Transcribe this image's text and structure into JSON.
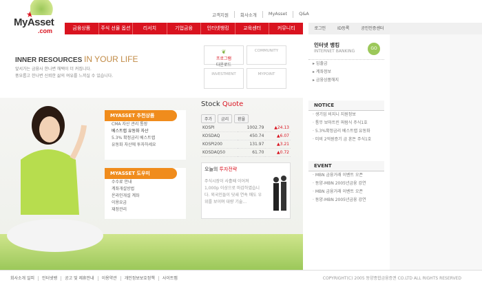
{
  "logo": {
    "name": "MyAsset",
    "domain": ".com"
  },
  "topnav": [
    "고객지원",
    "회사소개",
    "MyAsset",
    "Q&A"
  ],
  "menu": [
    "금융상품",
    "주식 선물 옵션",
    "리서치",
    "기업금융",
    "인터넷뱅킹",
    "교육센터",
    "커뮤니티"
  ],
  "util": [
    "로그인",
    "ID등록",
    "공인인증센터"
  ],
  "headline": {
    "prefix": "INNER RESOURCES ",
    "emph": "IN YOUR LIFE",
    "sub1": "앞서가는 금융사 한나변 해택이 더 커집니다.",
    "sub2": "풍요롭고 한나변 신뢰한 삶의 여유를 느끼실 수 있습니다."
  },
  "quick": [
    {
      "label": "프로그램",
      "sub": "다운로드"
    },
    {
      "label": "COMMUNITY"
    },
    {
      "label": "INVESTMENT"
    },
    {
      "label": "MYPOINT"
    }
  ],
  "card1": {
    "title": "MYASSET 추천상품",
    "l1": "CMA 자산 관리 통장",
    "l2": "베스트랩 유동화 자산",
    "l3": "5.3% 확정금리 베스트랩",
    "l4": "유동화 자산에 투자하세요"
  },
  "card2": {
    "title": "MYASSET 도우미",
    "items": [
      "수수료 안내",
      "계좌개설방법",
      "온라인개설 계좌",
      "이용요금",
      "재정관리"
    ]
  },
  "stock": {
    "title": "Stock ",
    "emph": "Quote",
    "tabs": [
      "주가",
      "금리",
      "환율"
    ],
    "rows": [
      [
        "KOSPI",
        "1002.79",
        "▲24.13"
      ],
      [
        "KOSDAQ",
        "450.74",
        "▲6.07"
      ],
      [
        "KOSPI200",
        "131.97",
        "▲3.21"
      ],
      [
        "KOSDAQ50",
        "61.70",
        "▲0.72"
      ]
    ]
  },
  "today": {
    "title": "오늘의 ",
    "emph": "투자전략",
    "text": "주식시장이 사흘째 이어져 1,000p 이상으로 마감하였습니다. 외국인들이 닷새 연속 매도 우위를 보이며 대량 기술..."
  },
  "banking": {
    "title": "인터넷 뱅킹",
    "sub": "INTERNET BANKING",
    "go": "GO",
    "items": [
      "입출금",
      "계좌정보",
      "금융상품해지"
    ]
  },
  "notice": {
    "title": "NOTICE",
    "items": [
      "생기업 비지니 지원정보",
      "통무 보마트린 퍼럼식 주식1호",
      "5.3%확정금리 베스트랩 유동화",
      "미비 2억원증기 금 혼돈 주식1호"
    ]
  },
  "event": {
    "title": "EVENT",
    "items": [
      "MBN 금융거래 이벤트 오픈",
      "동양-MBN 2005년금융 강연",
      "MBN 금융거래 이벤트 오픈",
      "동양-MBN 2005년금융 강연"
    ]
  },
  "footer": {
    "links": [
      "회사소개 일피",
      "인터넷뱅",
      "공고 및 제휴안내",
      "이용약관",
      "개인정보보호정책",
      "사이트맵"
    ],
    "copy": "COPYRIGHT(C) 2005 동양종합금융증권 CO.LTD ALL RIGHTS RESERVED"
  }
}
